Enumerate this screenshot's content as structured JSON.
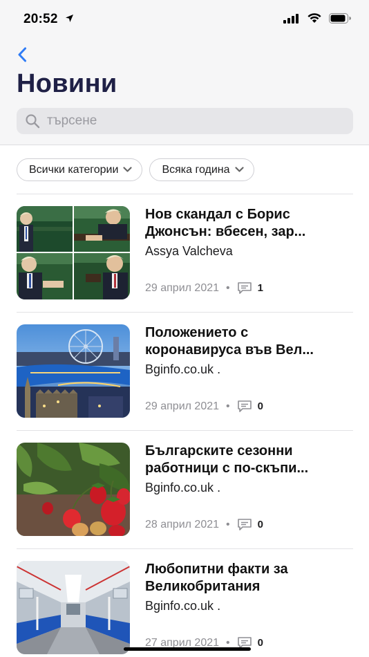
{
  "status_bar": {
    "time": "20:52",
    "icons": [
      "location-arrow-icon",
      "cellular-signal-icon",
      "wifi-icon",
      "battery-icon"
    ]
  },
  "header": {
    "back_icon": "chevron-left-icon",
    "title": "Новини",
    "search_placeholder": "търсене",
    "search_value": ""
  },
  "filters": {
    "category_label": "Всички категории",
    "year_label": "Всяка година"
  },
  "articles": [
    {
      "title_line1": "Нов скандал с Борис",
      "title_line2": "Джонсън: вбесен, зар...",
      "author": "Assya Valcheva",
      "date": "29 април 2021",
      "comments": "1",
      "thumb": "parliament-collage"
    },
    {
      "title_line1": "Положението с",
      "title_line2": "коронавируса във Вел...",
      "author": "Bginfo.co.uk .",
      "date": "29 април 2021",
      "comments": "0",
      "thumb": "london-night"
    },
    {
      "title_line1": "Българските сезонни",
      "title_line2": "работници с по-скъпи...",
      "author": "Bginfo.co.uk .",
      "date": "28 април 2021",
      "comments": "0",
      "thumb": "strawberries"
    },
    {
      "title_line1": "Любопитни факти за",
      "title_line2": "Великобритания",
      "author": "Bginfo.co.uk .",
      "date": "27 април 2021",
      "comments": "0",
      "thumb": "tube-train"
    }
  ],
  "colors": {
    "accent": "#2f7cf6",
    "title": "#1f2046",
    "meta": "#8e8e93",
    "header_bg": "#f6f6f7"
  }
}
